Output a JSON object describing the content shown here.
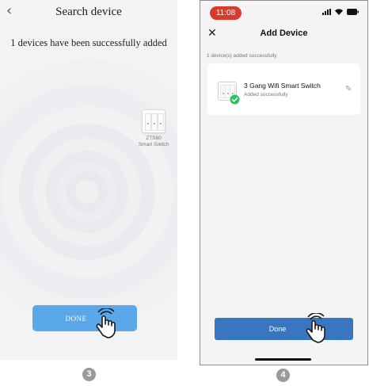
{
  "left_screen": {
    "back_icon": "chevron-left-icon",
    "title": "Search device",
    "message": "1 devices have been successfully added",
    "device_label_line1": "ZTS60",
    "device_label_line2": "Smart Switch",
    "done_label": "DONE"
  },
  "right_screen": {
    "time": "11:08",
    "title": "Add Device",
    "subtitle": "1 device(s) added successfully",
    "device_name": "3 Gang Wifi Smart Switch",
    "device_status": "Added successfully",
    "done_label": "Done"
  },
  "steps": [
    "3",
    "4"
  ],
  "colors": {
    "left_done": "#5aa7ea",
    "right_done": "#3a75bf",
    "check_green": "#2fbf62",
    "time_pill": "#d93a2b"
  }
}
